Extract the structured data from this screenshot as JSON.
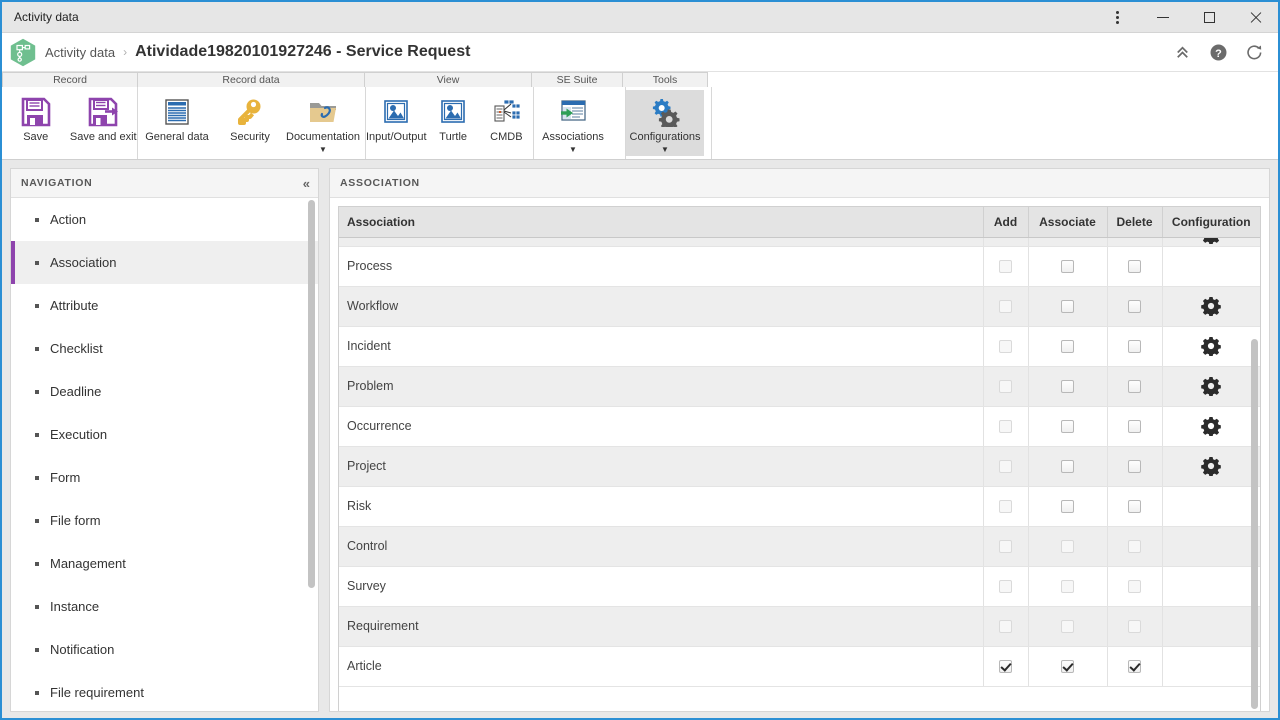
{
  "window": {
    "title": "Activity data",
    "controls": {
      "menu": "more-options",
      "minimize": "minimize",
      "maximize": "maximize",
      "close": "close"
    }
  },
  "header": {
    "logo_icon": "process-hexagon-icon",
    "breadcrumb_root": "Activity data",
    "breadcrumb_separator": "›",
    "title": "Atividade19820101927246 - Service Request",
    "icons": [
      {
        "name": "collapse-chevrons-icon",
        "label": "Collapse"
      },
      {
        "name": "help-icon",
        "label": "Help"
      },
      {
        "name": "refresh-icon",
        "label": "Refresh"
      }
    ]
  },
  "ribbon": {
    "groups": [
      {
        "key": "record",
        "label": "Record"
      },
      {
        "key": "recorddata",
        "label": "Record data"
      },
      {
        "key": "view",
        "label": "View"
      },
      {
        "key": "sesuite",
        "label": "SE Suite"
      },
      {
        "key": "tools",
        "label": "Tools"
      }
    ],
    "buttons": {
      "save": {
        "label": "Save",
        "icon": "save-floppy-icon",
        "caret": false,
        "active": false
      },
      "save_and_exit": {
        "label": "Save and exit",
        "icon": "save-exit-floppy-icon",
        "caret": false,
        "active": false
      },
      "general_data": {
        "label": "General data",
        "icon": "document-lines-icon",
        "caret": false,
        "active": false
      },
      "security": {
        "label": "Security",
        "icon": "key-icon",
        "caret": false,
        "active": false
      },
      "documentation": {
        "label": "Documentation",
        "icon": "folder-paperclip-icon",
        "caret": true,
        "active": false
      },
      "input_output": {
        "label": "Input/Output",
        "icon": "picture-icon",
        "caret": false,
        "active": false
      },
      "turtle": {
        "label": "Turtle",
        "icon": "picture-icon",
        "caret": false,
        "active": false
      },
      "cmdb": {
        "label": "CMDB",
        "icon": "cmdb-database-icon",
        "caret": false,
        "active": false
      },
      "associations": {
        "label": "Associations",
        "icon": "associations-icon",
        "caret": true,
        "active": false
      },
      "configurations": {
        "label": "Configurations",
        "icon": "gears-icon",
        "caret": true,
        "active": true
      }
    }
  },
  "navigation": {
    "title": "NAVIGATION",
    "collapse_icon": "collapse-left-icon",
    "selected": "Association",
    "items": [
      {
        "label": "Action"
      },
      {
        "label": "Association"
      },
      {
        "label": "Attribute"
      },
      {
        "label": "Checklist"
      },
      {
        "label": "Deadline"
      },
      {
        "label": "Execution"
      },
      {
        "label": "Form"
      },
      {
        "label": "File form"
      },
      {
        "label": "Management"
      },
      {
        "label": "Instance"
      },
      {
        "label": "Notification"
      },
      {
        "label": "File requirement"
      }
    ]
  },
  "association_panel": {
    "title": "ASSOCIATION",
    "columns": [
      "Association",
      "Add",
      "Associate",
      "Delete",
      "Configuration"
    ],
    "rows": [
      {
        "name": "",
        "add": false,
        "associate": false,
        "delete": false,
        "config": true,
        "partial": true,
        "dim": false
      },
      {
        "name": "Process",
        "add": false,
        "associate": false,
        "delete": false,
        "config": false,
        "partial": false,
        "dim": false
      },
      {
        "name": "Workflow",
        "add": false,
        "associate": false,
        "delete": false,
        "config": true,
        "partial": false,
        "dim": false
      },
      {
        "name": "Incident",
        "add": false,
        "associate": false,
        "delete": false,
        "config": true,
        "partial": false,
        "dim": false
      },
      {
        "name": "Problem",
        "add": false,
        "associate": false,
        "delete": false,
        "config": true,
        "partial": false,
        "dim": false
      },
      {
        "name": "Occurrence",
        "add": false,
        "associate": false,
        "delete": false,
        "config": true,
        "partial": false,
        "dim": false
      },
      {
        "name": "Project",
        "add": false,
        "associate": false,
        "delete": false,
        "config": true,
        "partial": false,
        "dim": false
      },
      {
        "name": "Risk",
        "add": false,
        "associate": false,
        "delete": false,
        "config": false,
        "partial": false,
        "dim": false
      },
      {
        "name": "Control",
        "add": false,
        "associate": false,
        "delete": false,
        "config": false,
        "partial": false,
        "dim": true
      },
      {
        "name": "Survey",
        "add": false,
        "associate": false,
        "delete": false,
        "config": false,
        "partial": false,
        "dim": true
      },
      {
        "name": "Requirement",
        "add": false,
        "associate": false,
        "delete": false,
        "config": false,
        "partial": false,
        "dim": true
      },
      {
        "name": "Article",
        "add": true,
        "associate": true,
        "delete": true,
        "config": false,
        "partial": false,
        "dim": false
      }
    ]
  },
  "colors": {
    "window_border": "#2b8fd4",
    "accent_selected": "#8e44ad",
    "save_icon": "#8e44ad",
    "key_icon": "#e8b33c",
    "document_icon": "#2b6cb0",
    "logo_green": "#6fbf8f",
    "gear_blue": "#2b7cc4",
    "gear_gray": "#5a5a5a"
  }
}
